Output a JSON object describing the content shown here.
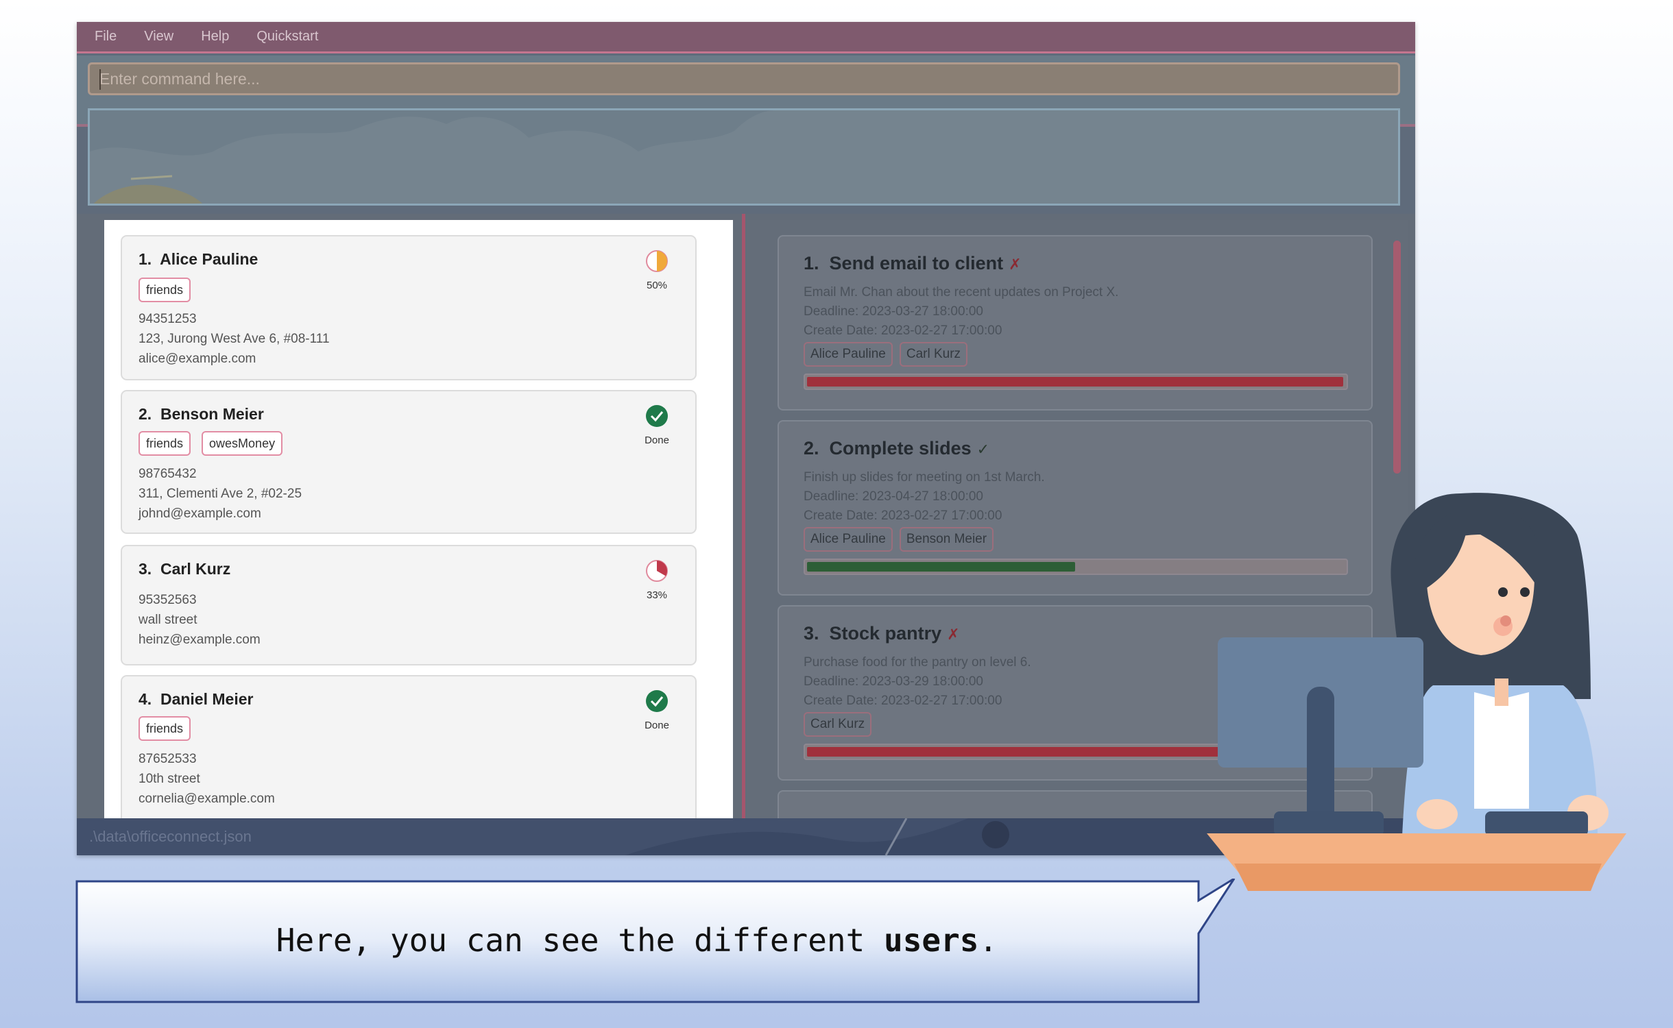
{
  "menu": [
    "File",
    "View",
    "Help",
    "Quickstart"
  ],
  "command_box": {
    "placeholder": "Enter command here..."
  },
  "persons": [
    {
      "index": "1.",
      "name": "Alice Pauline",
      "tags": [
        "friends"
      ],
      "phone": "94351253",
      "address": "123, Jurong West Ave 6, #08-111",
      "email": "alice@example.com",
      "status": "50%",
      "status_icon": "half-pie-icon",
      "progress": 0.5
    },
    {
      "index": "2.",
      "name": "Benson Meier",
      "tags": [
        "friends",
        "owesMoney"
      ],
      "phone": "98765432",
      "address": "311, Clementi Ave 2, #02-25",
      "email": "johnd@example.com",
      "status": "Done",
      "status_icon": "check-circle-icon",
      "progress": 1.0
    },
    {
      "index": "3.",
      "name": "Carl Kurz",
      "tags": [],
      "phone": "95352563",
      "address": "wall street",
      "email": "heinz@example.com",
      "status": "33%",
      "status_icon": "pie-icon",
      "progress": 0.33
    },
    {
      "index": "4.",
      "name": "Daniel Meier",
      "tags": [
        "friends"
      ],
      "phone": "87652533",
      "address": "10th street",
      "email": "cornelia@example.com",
      "status": "Done",
      "status_icon": "check-circle-icon",
      "progress": 1.0
    }
  ],
  "tasks": [
    {
      "index": "1.",
      "title": "Send email to client",
      "mark": "✗",
      "description": "Email Mr. Chan about the recent updates on Project X.",
      "deadline": "Deadline: 2023-03-27 18:00:00",
      "create_date": "Create Date: 2023-02-27 17:00:00",
      "assignees": [
        "Alice Pauline",
        "Carl Kurz"
      ],
      "progress": 1.0,
      "bar_color": "#a0303c"
    },
    {
      "index": "2.",
      "title": "Complete slides",
      "mark": "✓",
      "description": "Finish up slides for meeting on 1st March.",
      "deadline": "Deadline: 2023-04-27 18:00:00",
      "create_date": "Create Date: 2023-02-27 17:00:00",
      "assignees": [
        "Alice Pauline",
        "Benson Meier"
      ],
      "progress": 0.5,
      "bar_color": "#2d5e36"
    },
    {
      "index": "3.",
      "title": "Stock pantry",
      "mark": "✗",
      "description": "Purchase food for the pantry on level 6.",
      "deadline": "Deadline: 2023-03-29 18:00:00",
      "create_date": "Create Date: 2023-02-27 17:00:00",
      "assignees": [
        "Carl Kurz"
      ],
      "progress": 1.0,
      "bar_color": "#a0303c"
    }
  ],
  "status_bar": {
    "path": ".\\data\\officeconnect.json"
  },
  "tutorial": {
    "text_before": "Here, you can see the different ",
    "text_bold": "users",
    "text_after": "."
  },
  "colors": {
    "menu": "#7f5a6e",
    "accent_pink": "#e28da4",
    "done_green": "#1f7a4a",
    "progress_orange": "#f0a93b",
    "progress_red": "#c0394b"
  }
}
